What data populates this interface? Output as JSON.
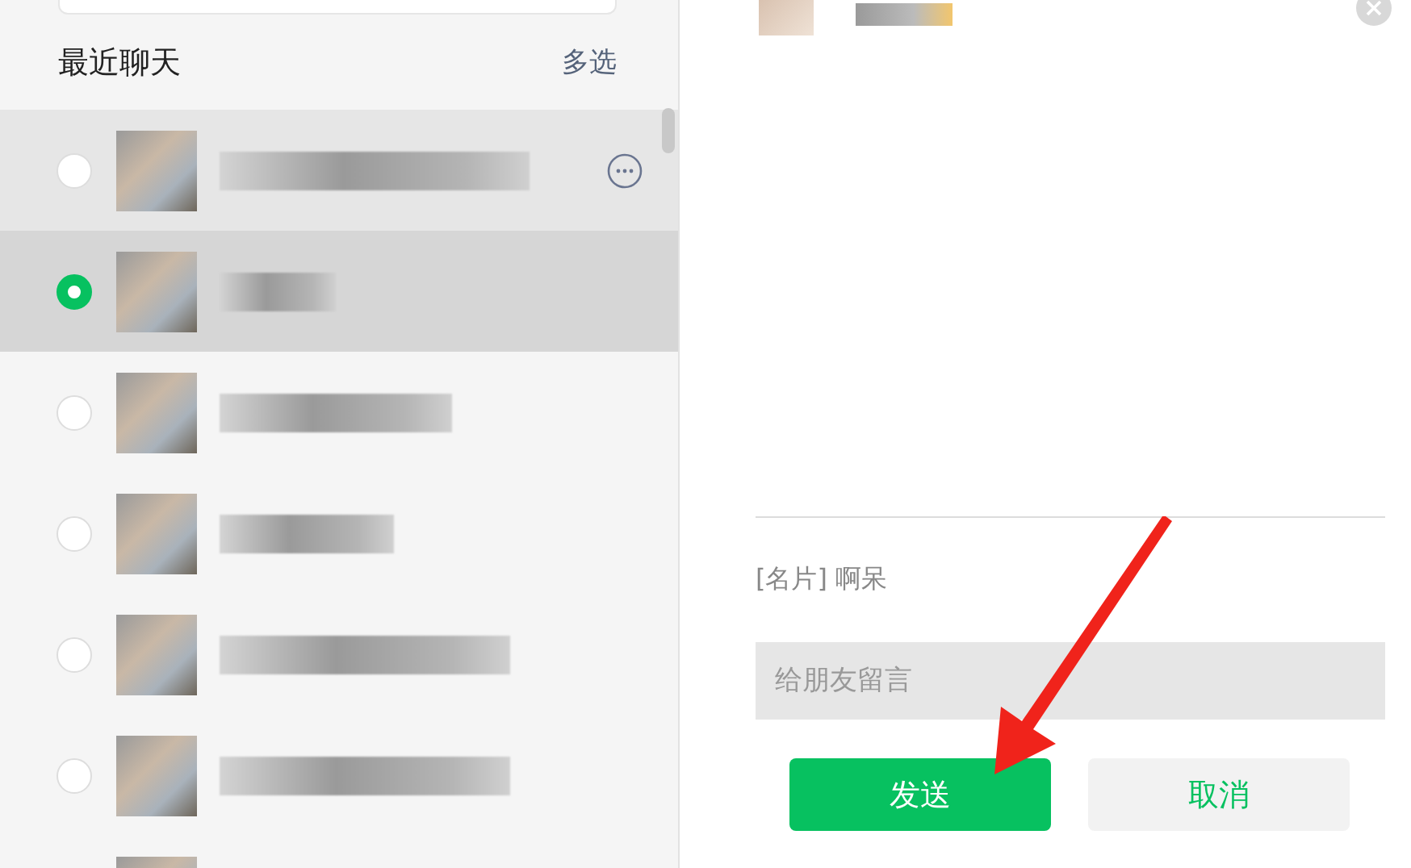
{
  "recent": {
    "title": "最近聊天",
    "multi_select": "多选"
  },
  "contacts": [
    {
      "selected": false,
      "hovered": true
    },
    {
      "selected": true,
      "hovered": false
    },
    {
      "selected": false,
      "hovered": false
    },
    {
      "selected": false,
      "hovered": false
    },
    {
      "selected": false,
      "hovered": false
    },
    {
      "selected": false,
      "hovered": false
    },
    {
      "selected": false,
      "hovered": false
    }
  ],
  "share": {
    "card_label": "[名片] 啊呆",
    "message": {
      "placeholder": "给朋友留言"
    },
    "send": "发送",
    "cancel": "取消"
  }
}
